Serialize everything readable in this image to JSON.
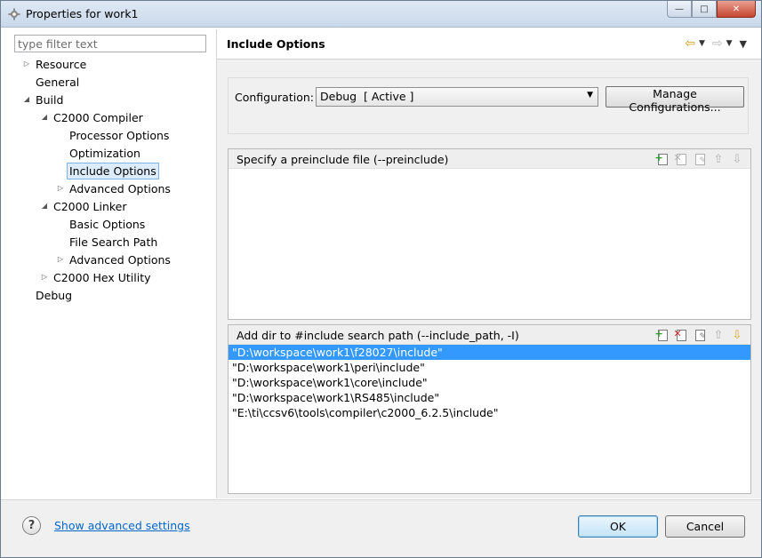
{
  "window": {
    "title": "Properties for work1",
    "icon": "gear-icon",
    "controls": [
      "minimize",
      "maximize",
      "close"
    ]
  },
  "filter": {
    "placeholder": "type filter text",
    "value": ""
  },
  "tree": [
    {
      "label": "Resource",
      "expander": "collapsed"
    },
    {
      "label": "General",
      "expander": "none"
    },
    {
      "label": "Build",
      "expander": "expanded"
    },
    {
      "label": "C2000 Compiler",
      "expander": "expanded"
    },
    {
      "label": "Processor Options",
      "expander": "none"
    },
    {
      "label": "Optimization",
      "expander": "none"
    },
    {
      "label": "Include Options",
      "expander": "none",
      "selected": true
    },
    {
      "label": "Advanced Options",
      "expander": "collapsed"
    },
    {
      "label": "C2000 Linker",
      "expander": "expanded"
    },
    {
      "label": "Basic Options",
      "expander": "none"
    },
    {
      "label": "File Search Path",
      "expander": "none"
    },
    {
      "label": "Advanced Options",
      "expander": "collapsed"
    },
    {
      "label": "C2000 Hex Utility",
      "expander": "collapsed"
    },
    {
      "label": "Debug",
      "expander": "none"
    }
  ],
  "page": {
    "title": "Include Options",
    "nav_icons": [
      "back-arrow-icon",
      "forward-arrow-icon",
      "view-menu-icon"
    ]
  },
  "configuration": {
    "label": "Configuration:",
    "selected": "Debug  [ Active ]",
    "manage_label": "Manage Configurations..."
  },
  "preinclude": {
    "header": "Specify a preinclude file (--preinclude)",
    "items": []
  },
  "include_path": {
    "header": "Add dir to #include search path (--include_path, -I)",
    "items": [
      "\"D:\\workspace\\work1\\f28027\\include\"",
      "\"D:\\workspace\\work1\\peri\\include\"",
      "\"D:\\workspace\\work1\\core\\include\"",
      "\"D:\\workspace\\work1\\RS485\\include\"",
      "\"E:\\ti\\ccsv6\\tools\\compiler\\c2000_6.2.5\\include\""
    ],
    "selected_index": 0
  },
  "tool_icons": [
    "add-icon",
    "delete-icon",
    "edit-icon",
    "move-up-icon",
    "move-down-icon"
  ],
  "footer": {
    "help_icon": "help-icon",
    "advanced_link": "Show advanced settings",
    "ok_label": "OK",
    "cancel_label": "Cancel"
  }
}
